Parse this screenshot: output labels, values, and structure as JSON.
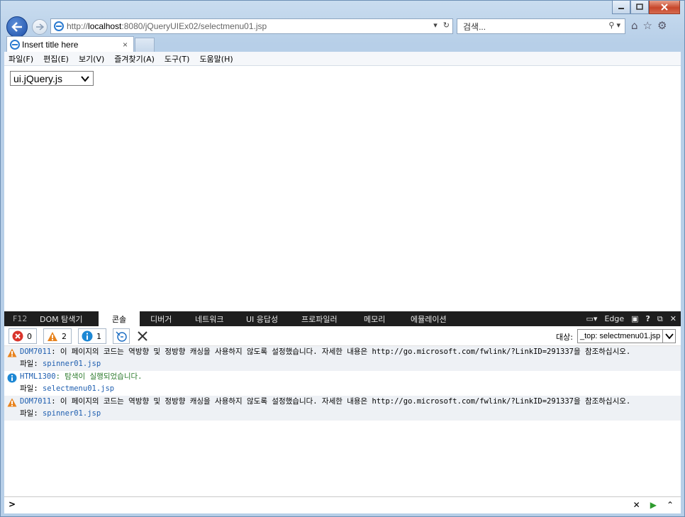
{
  "window": {
    "controls": [
      "minimize",
      "maximize",
      "close"
    ]
  },
  "address_bar": {
    "url_prefix": "http://",
    "url_host": "localhost",
    "url_rest": ":8080/jQueryUIEx02/selectmenu01.jsp",
    "search_placeholder": "검색..."
  },
  "tab": {
    "title": "Insert title here",
    "close": "×"
  },
  "menubar": [
    "파일(F)",
    "편집(E)",
    "보기(V)",
    "즐겨찾기(A)",
    "도구(T)",
    "도움말(H)"
  ],
  "page": {
    "select_value": "ui.jQuery.js"
  },
  "devtools": {
    "f12": "F12",
    "tabs": [
      "DOM 탐색기",
      "콘솔",
      "디버거",
      "네트워크",
      "UI 응답성",
      "프로파일러",
      "메모리",
      "에뮬레이션"
    ],
    "active_tab": "콘솔",
    "mode": "Edge",
    "help": "?",
    "counts": {
      "errors": "0",
      "warnings": "2",
      "info": "1"
    },
    "target_label": "대상:",
    "target_value": "_top: selectmenu01.jsp",
    "messages": [
      {
        "type": "warning",
        "code": "DOM7011",
        "text": ": 이 페이지의 코드는 역방향 및 정방향 캐싱을 사용하지 않도록 설정했습니다. 자세한 내용은 http://go.microsoft.com/fwlink/?LinkID=291337을 참조하십시오.",
        "file_label": "파일:",
        "file": "spinner01.jsp"
      },
      {
        "type": "info",
        "code": "HTML1300",
        "text": ": 탐색이 실행되었습니다.",
        "file_label": "파일:",
        "file": "selectmenu01.jsp"
      },
      {
        "type": "warning",
        "code": "DOM7011",
        "text": ": 이 페이지의 코드는 역방향 및 정방향 캐싱을 사용하지 않도록 설정했습니다. 자세한 내용은 http://go.microsoft.com/fwlink/?LinkID=291337을 참조하십시오.",
        "file_label": "파일:",
        "file": "spinner01.jsp"
      }
    ],
    "prompt": ">"
  }
}
